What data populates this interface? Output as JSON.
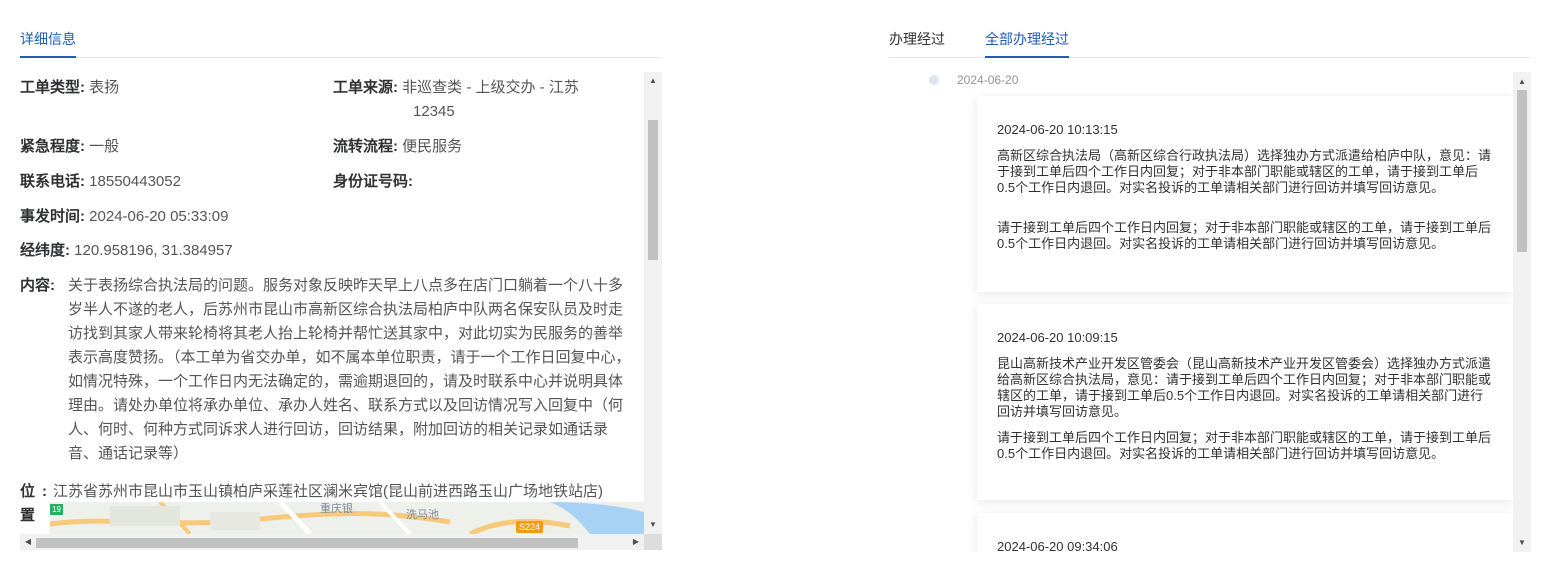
{
  "left": {
    "tab_label": "详细信息",
    "fields": {
      "type_label": "工单类型:",
      "type_value": "表扬",
      "source_label": "工单来源:",
      "source_value_line1": "非巡查类 - 上级交办 - 江苏",
      "source_value_line2": "12345",
      "urgency_label": "紧急程度:",
      "urgency_value": "一般",
      "flow_label": "流转流程:",
      "flow_value": "便民服务",
      "phone_label": "联系电话:",
      "phone_value": "18550443052",
      "idcard_label": "身份证号码:",
      "idcard_value": "",
      "time_label": "事发时间:",
      "time_value": "2024-06-20 05:33:09",
      "coords_label": "经纬度:",
      "coords_value": "120.958196, 31.384957",
      "content_label": "内容:",
      "content_value": "关于表扬综合执法局的问题。服务对象反映昨天早上八点多在店门口躺着一个八十多岁半人不遂的老人，后苏州市昆山市高新区综合执法局柏庐中队两名保安队员及时走访找到其家人带来轮椅将其老人抬上轮椅并帮忙送其家中，对此切实为民服务的善举表示高度赞扬。（本工单为省交办单，如不属本单位职责，请于一个工作日回复中心，如情况特殊，一个工作日内无法确定的，需逾期退回的，请及时联系中心并说明具体理由。请处办单位将承办单位、承办人姓名、联系方式以及回访情况写入回复中（何人、何时、何种方式同诉求人进行回访，回访结果，附加回访的相关记录如通话录音、通话记录等）",
      "location_label": "位置",
      "location_colon": ":",
      "location_value": "江苏省苏州市昆山市玉山镇柏庐采莲社区澜米宾馆(昆山前进西路玉山广场地铁站店)"
    },
    "map": {
      "label_a": "重庆银",
      "label_b": "洗马池",
      "road_badge": "S224",
      "road_badge_left": "19"
    }
  },
  "right": {
    "tabs": [
      "办理经过",
      "全部办理经过"
    ],
    "active_tab": 1,
    "timeline_date": "2024-06-20",
    "cards": [
      {
        "time": "2024-06-20 10:13:15",
        "text1": "高新区综合执法局（高新区综合行政执法局）选择独办方式派遣给柏庐中队，意见：请于接到工单后四个工作日内回复；对于非本部门职能或辖区的工单，请于接到工单后0.5个工作日内退回。对实名投诉的工单请相关部门进行回访并填写回访意见。",
        "text2": "请于接到工单后四个工作日内回复；对于非本部门职能或辖区的工单，请于接到工单后0.5个工作日内退回。对实名投诉的工单请相关部门进行回访并填写回访意见。"
      },
      {
        "time": "2024-06-20 10:09:15",
        "text1": "昆山高新技术产业开发区管委会（昆山高新技术产业开发区管委会）选择独办方式派遣给高新区综合执法局，意见：请于接到工单后四个工作日内回复；对于非本部门职能或辖区的工单，请于接到工单后0.5个工作日内退回。对实名投诉的工单请相关部门进行回访并填写回访意见。",
        "text2": "请于接到工单后四个工作日内回复；对于非本部门职能或辖区的工单，请于接到工单后0.5个工作日内退回。对实名投诉的工单请相关部门进行回访并填写回访意见。"
      },
      {
        "time": "2024-06-20 09:34:06"
      }
    ]
  },
  "colors": {
    "accent": "#1f5db8",
    "label": "#303133",
    "value": "#555555",
    "scrollbar": "#c1c1c1"
  }
}
